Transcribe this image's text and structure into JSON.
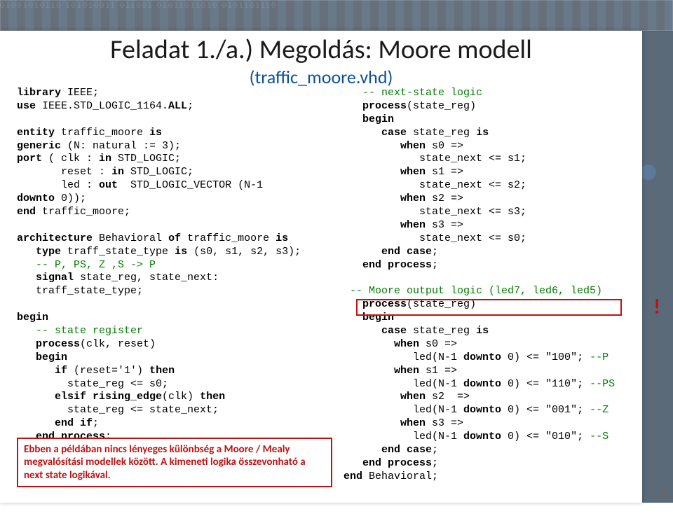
{
  "title": "Feladat 1./a.) Megoldás: Moore modell",
  "subtitle": "(traffic_moore.vhd)",
  "page_number": "4",
  "callout_text": "Ebben a példában nincs lényeges különbség a Moore / Mealy megvalósítási modellek között. A kimeneti logika összevonható a next state logikával.",
  "exclaim": "!",
  "left": {
    "l01a": "library",
    "l01b": " IEEE;",
    "l02a": "use",
    "l02b": " IEEE.STD_LOGIC_1164.",
    "l02c": "ALL",
    "l02d": ";",
    "l03": " ",
    "l04a": "entity",
    "l04b": " traffic_moore ",
    "l04c": "is",
    "l05a": "generic",
    "l05b": " (N: natural := 3);",
    "l06a": "port",
    "l06b": " ( clk : ",
    "l06c": "in",
    "l06d": " STD_LOGIC;",
    "l07a": "       reset : ",
    "l07b": "in",
    "l07c": " STD_LOGIC;",
    "l08a": "       led : ",
    "l08b": "out",
    "l08c": "  STD_LOGIC_VECTOR (N-1",
    "l09a": "downto",
    "l09b": " 0));",
    "l10a": "end",
    "l10b": " traffic_moore;",
    "l11": " ",
    "l12a": "architecture",
    "l12b": " Behavioral ",
    "l12c": "of",
    "l12d": " traffic_moore ",
    "l12e": "is",
    "l13a": "   ",
    "l13b": "type",
    "l13c": " traff_state_type ",
    "l13d": "is",
    "l13e": " (s0, s1, s2, s3);",
    "l14": "   -- P, PS, Z ,S -> P",
    "l15a": "   ",
    "l15b": "signal",
    "l15c": " state_reg, state_next:",
    "l16": "   traff_state_type;",
    "l17": " ",
    "l18": "begin",
    "l19": "   -- state register",
    "l20a": "   ",
    "l20b": "process",
    "l20c": "(clk, reset)",
    "l21a": "   ",
    "l21b": "begin",
    "l22a": "      ",
    "l22b": "if",
    "l22c": " (reset='1') ",
    "l22d": "then",
    "l23": "        state_reg <= s0;",
    "l24a": "      ",
    "l24b": "elsif rising_edge",
    "l24c": "(clk) ",
    "l24d": "then",
    "l25": "        state_reg <= state_next;",
    "l26a": "      ",
    "l26b": "end if",
    "l26c": ";",
    "l27a": "   ",
    "l27b": "end process",
    "l27c": ";"
  },
  "right": {
    "r01": "   -- next-state logic",
    "r02a": "   ",
    "r02b": "process",
    "r02c": "(state_reg)",
    "r03a": "   ",
    "r03b": "begin",
    "r04a": "      ",
    "r04b": "case",
    "r04c": " state_reg ",
    "r04d": "is",
    "r05a": "         ",
    "r05b": "when",
    "r05c": " s0 =>",
    "r06": "            state_next <= s1;",
    "r07a": "         ",
    "r07b": "when",
    "r07c": " s1 =>",
    "r08": "            state_next <= s2;",
    "r09a": "         ",
    "r09b": "when",
    "r09c": " s2 =>",
    "r10": "            state_next <= s3;",
    "r11a": "         ",
    "r11b": "when",
    "r11c": " s3 =>",
    "r12": "            state_next <= s0;",
    "r13a": "      ",
    "r13b": "end case",
    "r13c": ";",
    "r14a": "   ",
    "r14b": "end process",
    "r14c": ";",
    "r15": " ",
    "r16": " -- Moore output logic (led7, led6, led5)",
    "r17a": "   ",
    "r17b": "process",
    "r17c": "(state_reg)",
    "r18a": "   ",
    "r18b": "begin",
    "r19a": "      ",
    "r19b": "case",
    "r19c": " state_reg ",
    "r19d": "is",
    "r20a": "        ",
    "r20b": "when",
    "r20c": " s0 =>",
    "r21a": "           led(N-1 ",
    "r21b": "downto",
    "r21c": " 0) <= \"100\"; ",
    "r21d": "--P",
    "r22a": "        ",
    "r22b": "when",
    "r22c": " s1 =>",
    "r23a": "           led(N-1 ",
    "r23b": "downto",
    "r23c": " 0) <= \"110\"; ",
    "r23d": "--PS",
    "r24a": "         ",
    "r24b": "when",
    "r24c": " s2  =>",
    "r25a": "           led(N-1 ",
    "r25b": "downto",
    "r25c": " 0) <= \"001\"; ",
    "r25d": "--Z",
    "r26a": "         ",
    "r26b": "when",
    "r26c": " s3 =>",
    "r27a": "           led(N-1 ",
    "r27b": "downto",
    "r27c": " 0) <= \"010\"; ",
    "r27d": "--S",
    "r28a": "      ",
    "r28b": "end case",
    "r28c": ";",
    "r29a": "   ",
    "r29b": "end process",
    "r29c": ";",
    "r30a": "end",
    "r30b": " Behavioral;"
  }
}
